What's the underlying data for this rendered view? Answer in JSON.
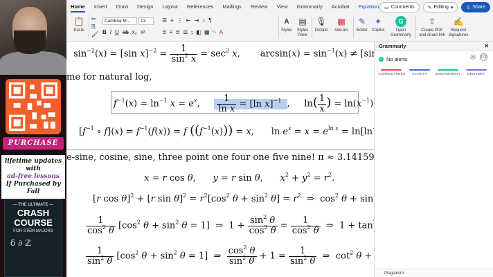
{
  "ribbon": {
    "tabs": [
      "Home",
      "Insert",
      "Draw",
      "Design",
      "Layout",
      "References",
      "Mailings",
      "Review",
      "View",
      "Grammarly",
      "Acrobat",
      "Equation"
    ],
    "comments_label": "Comments",
    "editing_label": "Editing",
    "share_label": "Share",
    "paste_label": "Paste",
    "font_name": "Cambria M...",
    "font_size": "13",
    "styles_label": "Styles",
    "styles_pane_label": "Styles Pane",
    "dictate_label": "Dictate",
    "addins_label": "Add-ins",
    "editor_label": "Editor",
    "copilot_label": "Copilot",
    "open_grammarly_label": "Open Grammarly",
    "create_pdf_label": "Create PDF and share link",
    "request_sig_label": "Request Signatures"
  },
  "promo": {
    "purchase_label": "PURCHASE",
    "line1": "lifetime updates with",
    "line2": "ad-free lessons",
    "line3": "If Purchased by Fall",
    "book_top": "— THE ULTIMATE —",
    "book_title_1": "CRASH COURSE",
    "book_sub": "FOR STEM MAJORS",
    "book_symbols": "δ ∂ ℤ"
  },
  "document": {
    "prose_natural_log": "me for natural log,",
    "prose_pi": "e-sine, cosine, sine, three point one four one five nine! π ≈ 3.14159",
    "sep1": ",",
    "sep2": ","
  },
  "grammarly": {
    "title": "Grammarly",
    "alerts": "No alerts",
    "categories": [
      {
        "label": "CORRECTNESS",
        "color": "#e5484d"
      },
      {
        "label": "CLARITY",
        "color": "#3b6ee8"
      },
      {
        "label": "ENGAGEMENT",
        "color": "#15c39a"
      },
      {
        "label": "DELIVERY",
        "color": "#9b5de5"
      }
    ],
    "footer": "Plagiarism"
  }
}
